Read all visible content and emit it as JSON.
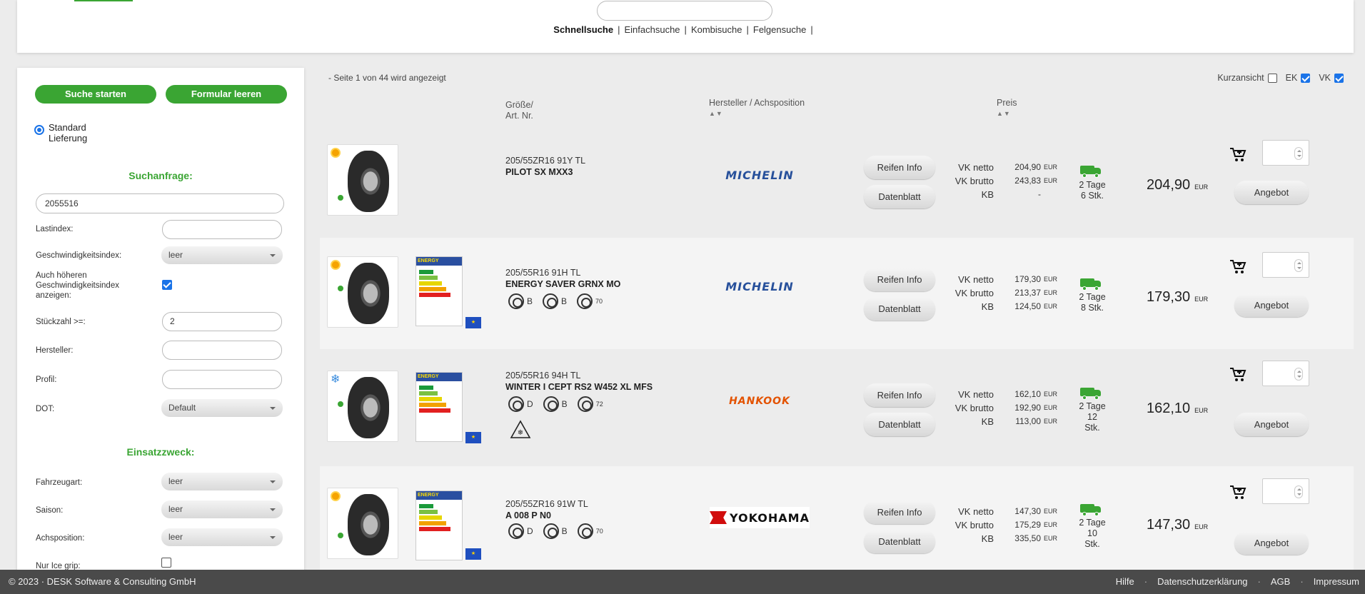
{
  "search_modes": [
    "Schnellsuche",
    "Einfachsuche",
    "Kombisuche",
    "Felgensuche"
  ],
  "sidebar": {
    "start_label": "Suche starten",
    "clear_label": "Formular leeren",
    "radio_label": "Standard Lieferung",
    "section_query": "Suchanfrage:",
    "query_value": "2055516",
    "fields": {
      "lastindex": "Lastindex:",
      "speedindex": "Geschwindigkeitsindex:",
      "speedindex_value": "leer",
      "higher_speed": "Auch höheren Geschwindigkeitsindex anzeigen:",
      "qty": "Stückzahl >=:",
      "qty_value": "2",
      "manufacturer": "Hersteller:",
      "profile": "Profil:",
      "dot": "DOT:",
      "dot_value": "Default"
    },
    "section_usage": "Einsatzzweck:",
    "usage": {
      "vehicle": "Fahrzeugart:",
      "vehicle_value": "leer",
      "season": "Saison:",
      "season_value": "leer",
      "axle": "Achsposition:",
      "axle_value": "leer",
      "ice": "Nur Ice grip:"
    }
  },
  "results": {
    "page_info": "- Seite 1 von 44 wird angezeigt",
    "view": {
      "short": "Kurzansicht",
      "ek": "EK",
      "vk": "VK"
    },
    "headers": {
      "size": "Größe/",
      "artnr": "Art. Nr.",
      "manufacturer": "Hersteller / Achsposition",
      "price": "Preis",
      "sort": "▲▼"
    },
    "labels": {
      "vk_netto": "VK netto",
      "vk_brutto": "VK brutto",
      "kb": "KB",
      "eur": "EUR",
      "info": "Reifen Info",
      "datasheet": "Datenblatt",
      "offer": "Angebot"
    },
    "items": [
      {
        "size": "205/55ZR16 91Y TL",
        "model": "PILOT SX MXX3",
        "brand": "MICHELIN",
        "vk_netto": "204,90",
        "vk_brutto": "243,83",
        "kb": "-",
        "days": "2 Tage",
        "stock": "6 Stk.",
        "price": "204,90"
      },
      {
        "size": "205/55R16 91H TL",
        "model": "ENERGY SAVER GRNX MO",
        "brand": "MICHELIN",
        "fuel": "B",
        "wet": "B",
        "noise": "70",
        "vk_netto": "179,30",
        "vk_brutto": "213,37",
        "kb": "124,50",
        "days": "2 Tage",
        "stock": "8 Stk.",
        "price": "179,30"
      },
      {
        "size": "205/55R16 94H TL",
        "model": "WINTER I CEPT RS2 W452 XL MFS",
        "brand": "HANKOOK",
        "fuel": "D",
        "wet": "B",
        "noise": "72",
        "vk_netto": "162,10",
        "vk_brutto": "192,90",
        "kb": "113,00",
        "days": "2 Tage",
        "stock": "12",
        "stock2": "Stk.",
        "price": "162,10"
      },
      {
        "size": "205/55ZR16 91W TL",
        "model": "A 008 P N0",
        "brand": "YOKOHAMA",
        "fuel": "D",
        "wet": "B",
        "noise": "70",
        "vk_netto": "147,30",
        "vk_brutto": "175,29",
        "kb": "335,50",
        "days": "2 Tage",
        "stock": "10",
        "stock2": "Stk.",
        "price": "147,30"
      }
    ]
  },
  "footer": {
    "copyright": "© 2023 · DESK Software & Consulting GmbH",
    "links": [
      "Hilfe",
      "Datenschutzerklärung",
      "AGB",
      "Impressum"
    ]
  }
}
